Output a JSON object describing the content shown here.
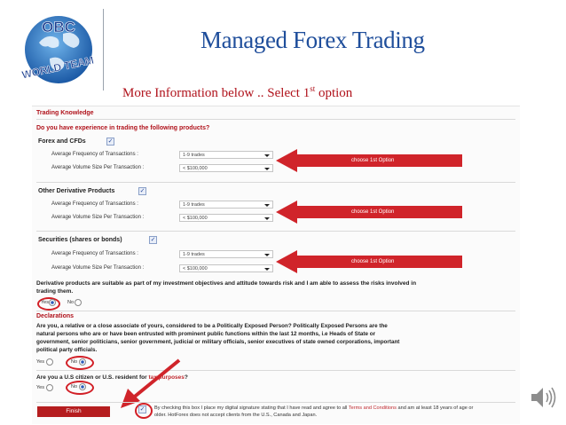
{
  "slide": {
    "title": "Managed Forex Trading",
    "subtitle_main": "More Information below .. Select 1",
    "subtitle_sup": "st",
    "subtitle_end": " option"
  },
  "logo": {
    "top_text": "OBC",
    "bottom_text": "WORLD TEAM"
  },
  "form": {
    "section_title": "Trading Knowledge",
    "question": "Do you have experience in trading the following products?",
    "products": [
      {
        "label": "Forex and CFDs",
        "freq_label": "Average Frequency of Transactions :",
        "freq_value": "1-9 trades",
        "vol_label": "Average Volume Size Per Transaction :",
        "vol_value": "< $100,000",
        "arrow_text": "choose 1st Option"
      },
      {
        "label": "Other Derivative Products",
        "freq_label": "Average Frequency of Transactions :",
        "freq_value": "1-9 trades",
        "vol_label": "Average Volume Size Per Transaction :",
        "vol_value": "< $100,000",
        "arrow_text": "choose 1st Option"
      },
      {
        "label": "Securities (shares or bonds)",
        "freq_label": "Average Frequency of Transactions :",
        "freq_value": "1-9 trades",
        "vol_label": "Average Volume Size Per Transaction :",
        "vol_value": "< $100,000",
        "arrow_text": "choose 1st Option"
      }
    ],
    "suitability_line1": "Derivative products are suitable as part of my investment objectives and attitude towards risk and I am able to assess the risks involved in",
    "suitability_line2": "trading them.",
    "yes": "Yes",
    "no": "No",
    "declarations_title": "Declarations",
    "pep_line1": "Are you, a relative or a close associate of yours, considered to be a Politically Exposed Person? Politically Exposed Persons are the",
    "pep_line2": "natural persons who are or have been entrusted with prominent public functions within the last 12 months, i.e Heads of State or",
    "pep_line3": "government, senior politicians, senior government, judicial or military officials, senior executives of state owned corporations, important",
    "pep_line4": "political party officials.",
    "us_question": "Are you a U.S citizen or U.S. resident for",
    "us_link": "tax purposes",
    "us_q_mark": "?",
    "finish": "Finish",
    "terms_line1_a": "By checking this box I place my digital signature stating that I have read and agree to all",
    "terms_link": "Terms and Conditions",
    "terms_line1_b": "and am at least 18 years of age or",
    "terms_line2": "older. HotForex does not accept clients from the U.S., Canada and Japan."
  },
  "colors": {
    "title_blue": "#1f4e9b",
    "subtitle_red": "#b0121b",
    "arrow_red": "#d0242a",
    "finish_red": "#b51d1f"
  }
}
